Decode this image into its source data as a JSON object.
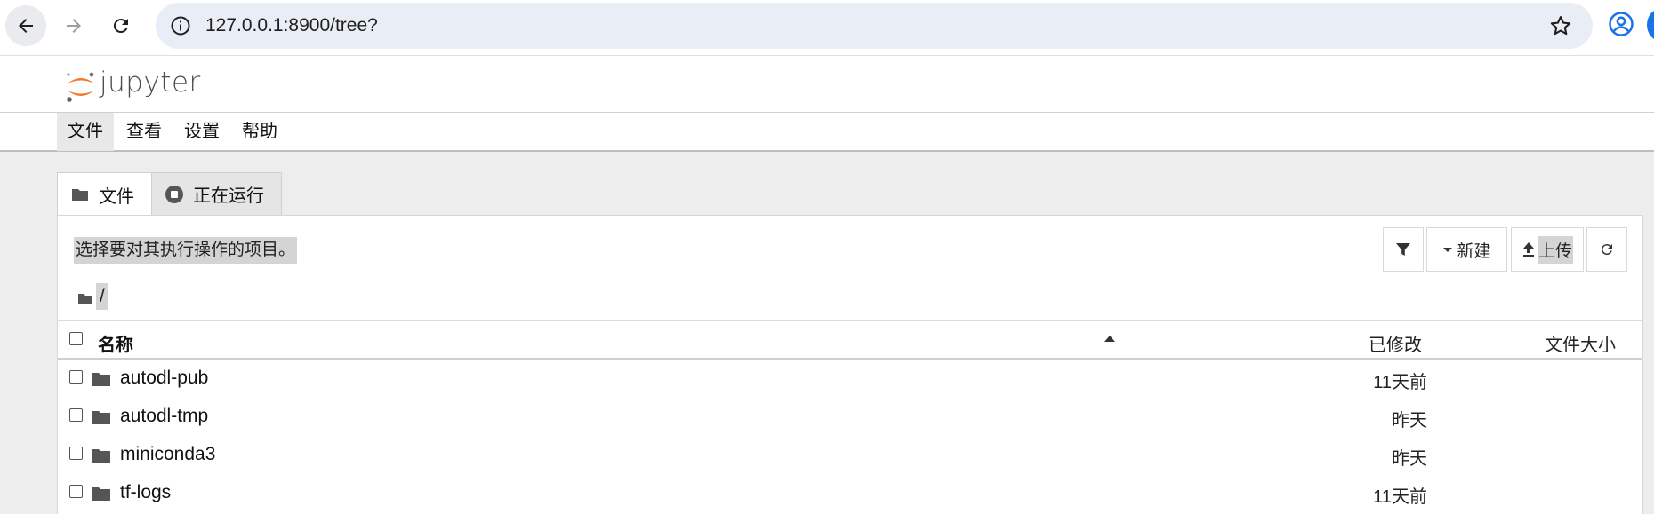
{
  "browser": {
    "url": "127.0.0.1:8900/tree?"
  },
  "header": {
    "logo_text": "jupyter"
  },
  "menu": {
    "items": [
      {
        "label": "文件",
        "active": true
      },
      {
        "label": "查看"
      },
      {
        "label": "设置"
      },
      {
        "label": "帮助"
      }
    ]
  },
  "tabs": [
    {
      "label": "文件",
      "icon": "folder-icon",
      "active": true
    },
    {
      "label": "正在运行",
      "icon": "stop-circle-icon"
    }
  ],
  "toolbar": {
    "hint": "选择要对其执行操作的项目。",
    "filter_icon": "filter-icon",
    "new_label": "新建",
    "upload_label": "上传",
    "refresh_icon": "refresh-icon"
  },
  "breadcrumb": {
    "root": "/"
  },
  "table": {
    "headers": {
      "name": "名称",
      "modified": "已修改",
      "size": "文件大小"
    },
    "rows": [
      {
        "name": "autodl-pub",
        "modified": "11天前"
      },
      {
        "name": "autodl-tmp",
        "modified": "昨天"
      },
      {
        "name": "miniconda3",
        "modified": "昨天"
      },
      {
        "name": "tf-logs",
        "modified": "11天前"
      }
    ]
  },
  "colors": {
    "jupyter_orange": "#f37726",
    "selection_bg": "#d4d4d4",
    "page_bg": "#ededed"
  }
}
